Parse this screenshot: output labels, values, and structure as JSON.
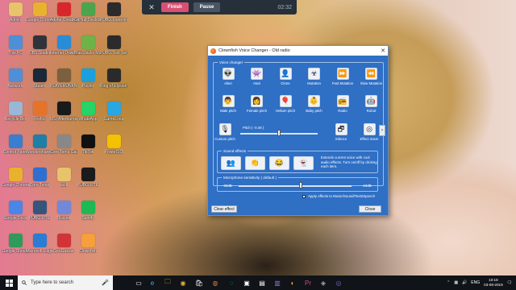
{
  "recorder": {
    "finish_label": "Finish",
    "pause_label": "Pause",
    "time": "02:32"
  },
  "desktop": {
    "col1": [
      {
        "label": "Admin",
        "icon": "user-folder-icon",
        "color": "#e7c36b"
      },
      {
        "label": "This PC",
        "icon": "computer-icon",
        "color": "#4e8fd6"
      },
      {
        "label": "Network",
        "icon": "network-icon",
        "color": "#4e8fd6"
      },
      {
        "label": "Recycle Bin",
        "icon": "recycle-bin-icon",
        "color": "#9ab7d6"
      },
      {
        "label": "Control Panel",
        "icon": "control-panel-icon",
        "color": "#3a7ed0"
      },
      {
        "label": "Google Chrome",
        "icon": "chrome-icon",
        "color": "#e9b22e"
      },
      {
        "label": "Google Docs",
        "icon": "docs-icon",
        "color": "#4a86e8"
      },
      {
        "label": "Google Sheets",
        "icon": "sheets-icon",
        "color": "#2e9b5a"
      }
    ],
    "col2": [
      {
        "label": "Google Chrome",
        "icon": "chrome-icon",
        "color": "#e9b22e"
      },
      {
        "label": "OBS Studio",
        "icon": "obs-icon",
        "color": "#30343a"
      },
      {
        "label": "Steam",
        "icon": "steam-icon",
        "color": "#1b2838"
      },
      {
        "label": "Firefox",
        "icon": "firefox-icon",
        "color": "#e5742a"
      },
      {
        "label": "Wondershare Filmora",
        "icon": "filmora-icon",
        "color": "#1f7fa6"
      },
      {
        "label": "Core Temp",
        "icon": "core-temp-icon",
        "color": "#2f6fd0"
      },
      {
        "label": "PUBG LITE",
        "icon": "pubg-lite-icon",
        "color": "#35557d"
      },
      {
        "label": "Microsoft Edge",
        "icon": "edge-icon",
        "color": "#2b7cd3"
      }
    ],
    "col3": [
      {
        "label": "Adobe Creative Cloud",
        "icon": "creative-cloud-icon",
        "color": "#d8262b"
      },
      {
        "label": "Internet Download Manager",
        "icon": "idm-icon",
        "color": "#2a8bd6"
      },
      {
        "label": "PLAYERUNKNOWN'S BATTLEGROUNDS",
        "icon": "pubg-icon",
        "color": "#7b6040"
      },
      {
        "label": "MSI Afterburner",
        "icon": "afterburner-icon",
        "color": "#1a1a1a"
      },
      {
        "label": "Core Temp Gadget",
        "icon": "gadget-icon",
        "color": "#888888"
      },
      {
        "label": "acd",
        "icon": "folder-icon",
        "color": "#e7c36b"
      },
      {
        "label": "Discord",
        "icon": "discord-icon",
        "color": "#7289da"
      },
      {
        "label": "GeoGuessr",
        "icon": "download-icon",
        "color": "#d13438"
      }
    ],
    "col4": [
      {
        "label": "GitHub Desktop",
        "icon": "bluestacks-icon",
        "color": "#4ca44c"
      },
      {
        "label": "BlueStacks Multi-Instance",
        "icon": "bluestacks-icon",
        "color": "#6fb247"
      },
      {
        "label": "Paytm",
        "icon": "paytm-icon",
        "color": "#1aa0dd"
      },
      {
        "label": "WhatsApp",
        "icon": "whatsapp-icon",
        "color": "#25d366"
      },
      {
        "label": "TikTok",
        "icon": "tiktok-icon",
        "color": "#111111"
      },
      {
        "label": "PUBG LITE",
        "icon": "pubg-icon",
        "color": "#1b1b1b"
      },
      {
        "label": "Spotify",
        "icon": "spotify-icon",
        "color": "#1db954"
      },
      {
        "label": "Clownfish",
        "icon": "clownfish-icon",
        "color": "#f5a03a"
      }
    ],
    "col5": [
      {
        "label": "PUBG Experimental",
        "icon": "pubg-icon",
        "color": "#2b2b2b"
      },
      {
        "label": "PUBG Test Server",
        "icon": "pubg-icon",
        "color": "#2b2b2b"
      },
      {
        "label": "Ring of Elysium",
        "icon": "roe-icon",
        "color": "#2a2a2a"
      },
      {
        "label": "GameLoop",
        "icon": "gameloop-icon",
        "color": "#2aa6e0"
      },
      {
        "label": "PowerISO",
        "icon": "power-icon",
        "color": "#f2c100"
      }
    ]
  },
  "clownfish": {
    "title": "Clownfish Voice Changer - Old radio",
    "voice_group_title": "Voice changer",
    "voices_row1": [
      {
        "label": "Alien",
        "icon": "alien-icon"
      },
      {
        "label": "Atari",
        "icon": "atari-icon"
      },
      {
        "label": "Clone",
        "icon": "clone-icon"
      },
      {
        "label": "Mutation",
        "icon": "mutation-icon"
      },
      {
        "label": "Fast Mutation",
        "icon": "fast-mutation-icon"
      },
      {
        "label": "Slow Mutation",
        "icon": "slow-mutation-icon"
      }
    ],
    "voices_row2": [
      {
        "label": "Male pitch",
        "icon": "male-icon"
      },
      {
        "label": "Female pitch",
        "icon": "female-icon"
      },
      {
        "label": "Helium pitch",
        "icon": "helium-icon"
      },
      {
        "label": "Baby pitch",
        "icon": "baby-icon"
      },
      {
        "label": "Radio",
        "icon": "radio-icon"
      },
      {
        "label": "Robot",
        "icon": "robot-icon"
      }
    ],
    "custom_pitch_label": "Custom pitch",
    "pitch_text": "Pitch ( -0.46 )",
    "pitch_value": -0.46,
    "pitch_fill": 0.5,
    "silence_label": "Silence",
    "effect_mixer_label": "Effect mixer",
    "sound_effects_title": "Sound effects",
    "sound_effects_desc": "Extends current voice with cool audio effects. Turn on/off by clicking each item.",
    "mic_sensitivity_title": "Microphone sensitivity ( default )",
    "mic_min": "-60dB",
    "mic_max": "-10dB",
    "mic_fill": 0.55,
    "apply_label": "Apply effects to Music/Sound/Text2Speech",
    "clear_label": "Clear effect",
    "close_label": "Close"
  },
  "taskbar": {
    "search_placeholder": "Type here to search",
    "lang": "ENG",
    "time": "10:18",
    "date": "03-08-2019"
  }
}
